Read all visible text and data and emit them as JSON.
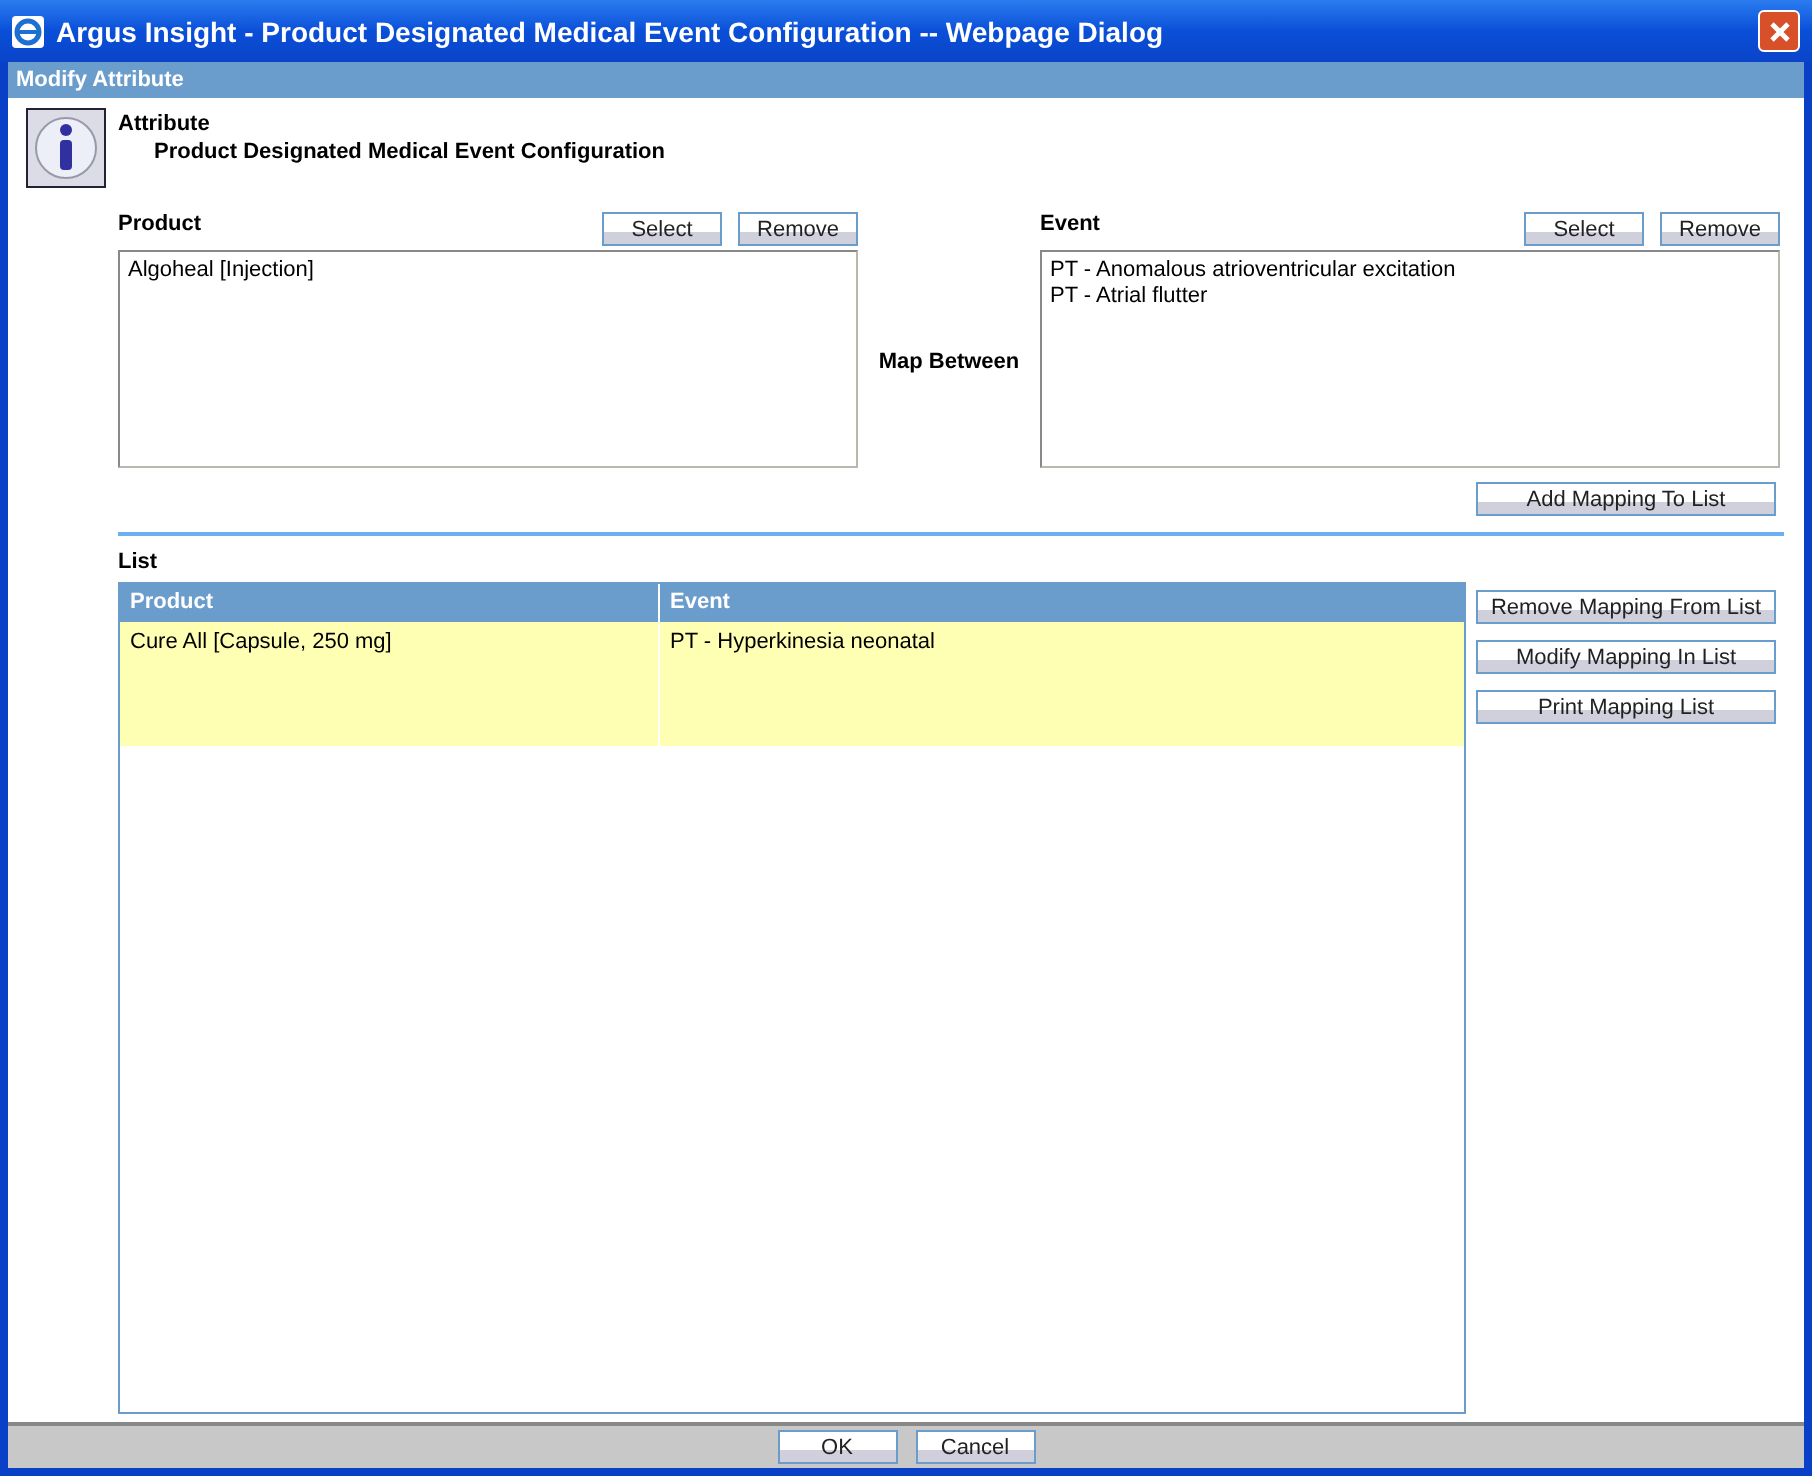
{
  "window": {
    "title": "Argus Insight - Product Designated Medical Event Configuration -- Webpage Dialog"
  },
  "header": "Modify Attribute",
  "attribute": {
    "label": "Attribute",
    "value": "Product Designated Medical Event Configuration"
  },
  "product": {
    "label": "Product",
    "buttons": [
      "Select",
      "Remove"
    ],
    "items": [
      "Algoheal [Injection]"
    ]
  },
  "map_label": "Map Between",
  "event": {
    "label": "Event",
    "buttons": [
      "Select",
      "Remove"
    ],
    "items": [
      "PT - Anomalous atrioventricular excitation",
      "PT - Atrial flutter"
    ]
  },
  "add_button": "Add Mapping To List",
  "list": {
    "label": "List",
    "columns": [
      "Product",
      "Event"
    ],
    "rows": [
      {
        "cells": [
          "Cure All [Capsule, 250 mg]",
          "PT - Hyperkinesia neonatal"
        ],
        "selected": true
      }
    ],
    "buttons": [
      "Remove Mapping From List",
      "Modify Mapping In List",
      "Print Mapping List"
    ]
  },
  "footer_buttons": [
    "OK",
    "Cancel"
  ]
}
